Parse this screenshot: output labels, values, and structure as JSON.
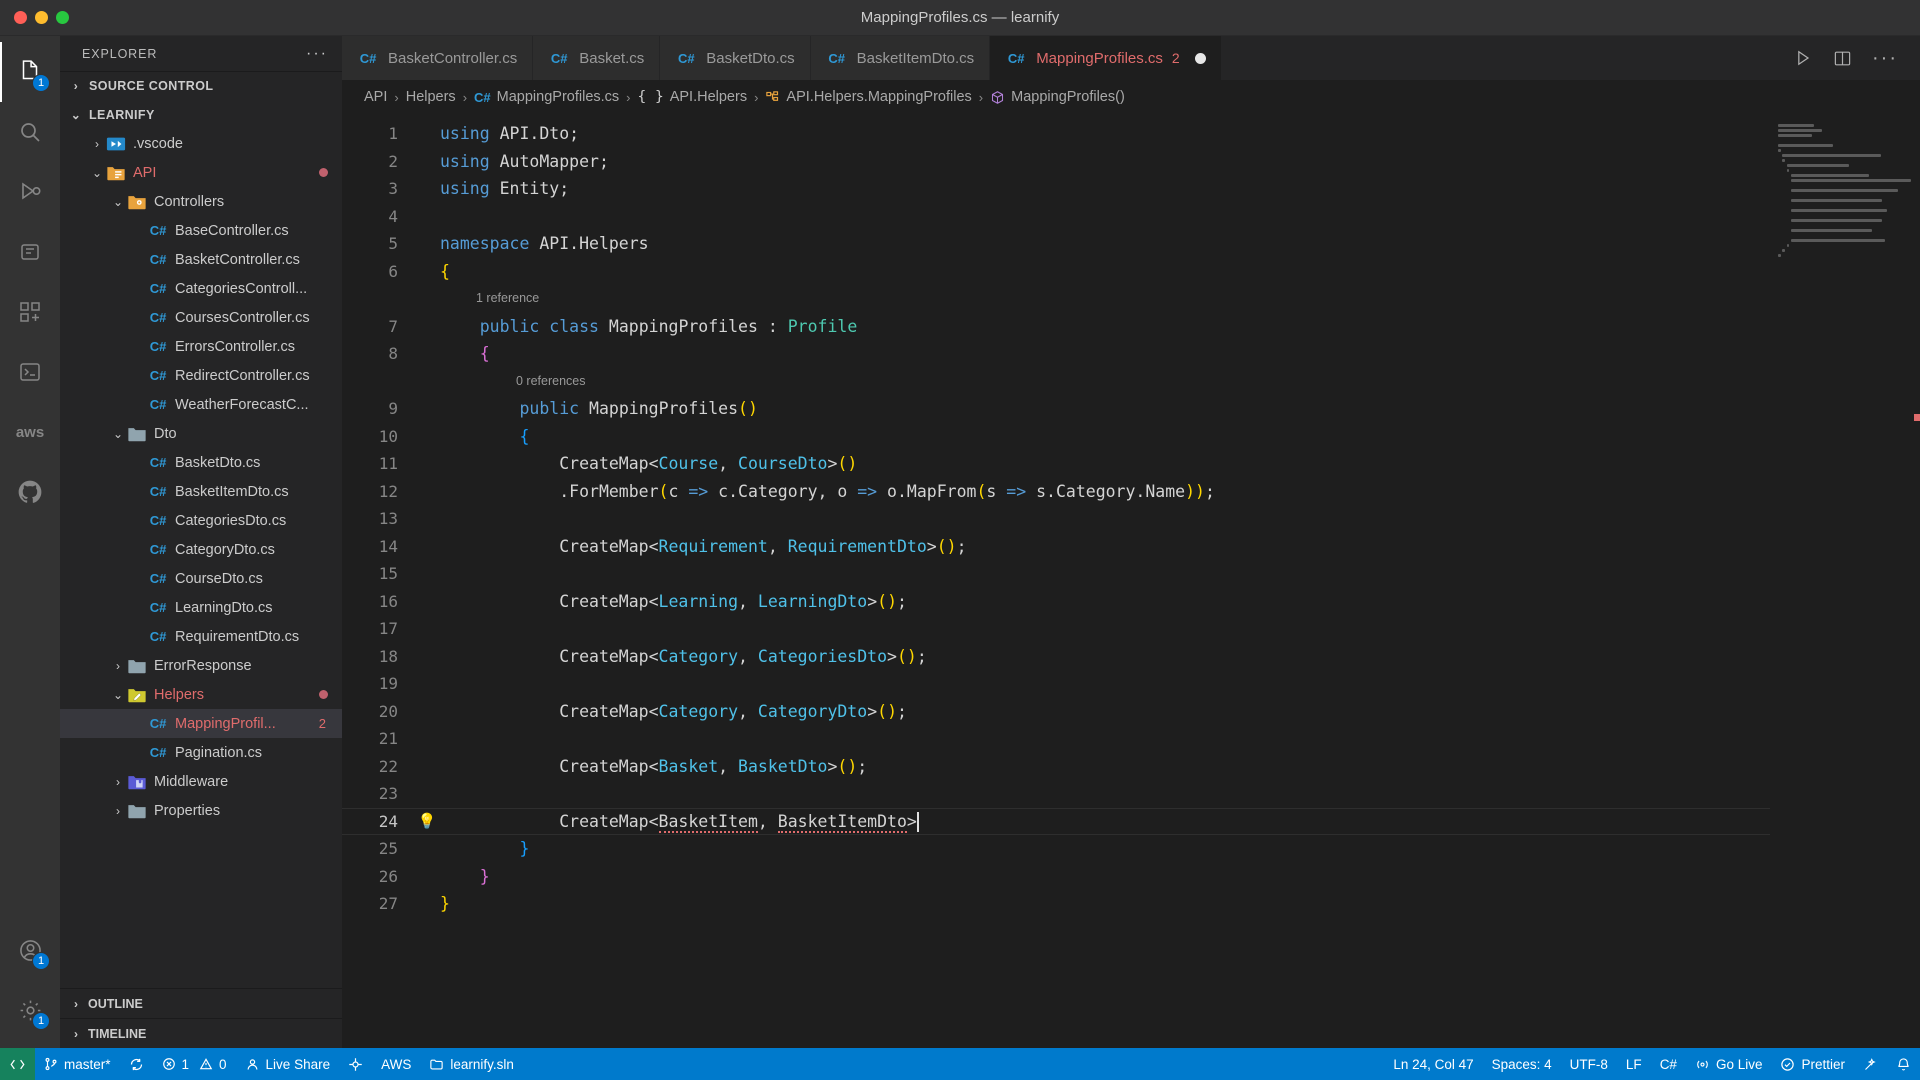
{
  "window": {
    "title": "MappingProfiles.cs — learnify"
  },
  "activity_bar": {
    "items": [
      {
        "name": "explorer",
        "icon": "files-icon",
        "badge": "1",
        "active": true
      },
      {
        "name": "search",
        "icon": "search-icon",
        "badge": ""
      },
      {
        "name": "run-debug",
        "icon": "run-debug-icon",
        "badge": ""
      },
      {
        "name": "testing",
        "icon": "beaker-icon",
        "badge": ""
      },
      {
        "name": "extensions",
        "icon": "extensions-icon",
        "badge": ""
      },
      {
        "name": "terminal-azure",
        "icon": "azure-icon",
        "badge": ""
      },
      {
        "name": "aws-toolkit",
        "icon": "aws-icon",
        "badge": ""
      },
      {
        "name": "github",
        "icon": "github-icon",
        "badge": ""
      }
    ],
    "bottom_items": [
      {
        "name": "accounts",
        "icon": "account-icon",
        "badge": "1"
      },
      {
        "name": "settings",
        "icon": "gear-icon",
        "badge": "1"
      }
    ]
  },
  "sidebar": {
    "header": "EXPLORER",
    "more_actions": "···",
    "sections": [
      {
        "label": "SOURCE CONTROL",
        "expanded": false
      }
    ],
    "root": {
      "label": "LEARNIFY",
      "expanded": true
    },
    "tree": [
      {
        "label": ".vscode",
        "type": "folder",
        "icon": "vscode-folder-icon",
        "depth": 1,
        "expanded": false,
        "color": "normal"
      },
      {
        "label": "API",
        "type": "folder",
        "icon": "api-folder-icon",
        "depth": 1,
        "expanded": true,
        "color": "error",
        "modified": true
      },
      {
        "label": "Controllers",
        "type": "folder",
        "icon": "controllers-folder-icon",
        "depth": 2,
        "expanded": true,
        "color": "normal"
      },
      {
        "label": "BaseController.cs",
        "type": "file",
        "icon": "csharp-icon",
        "depth": 3,
        "color": "normal"
      },
      {
        "label": "BasketController.cs",
        "type": "file",
        "icon": "csharp-icon",
        "depth": 3,
        "color": "normal"
      },
      {
        "label": "CategoriesControll...",
        "type": "file",
        "icon": "csharp-icon",
        "depth": 3,
        "color": "normal"
      },
      {
        "label": "CoursesController.cs",
        "type": "file",
        "icon": "csharp-icon",
        "depth": 3,
        "color": "normal"
      },
      {
        "label": "ErrorsController.cs",
        "type": "file",
        "icon": "csharp-icon",
        "depth": 3,
        "color": "normal"
      },
      {
        "label": "RedirectController.cs",
        "type": "file",
        "icon": "csharp-icon",
        "depth": 3,
        "color": "normal"
      },
      {
        "label": "WeatherForecastC...",
        "type": "file",
        "icon": "csharp-icon",
        "depth": 3,
        "color": "normal"
      },
      {
        "label": "Dto",
        "type": "folder",
        "icon": "plain-folder-icon",
        "depth": 2,
        "expanded": true,
        "color": "normal"
      },
      {
        "label": "BasketDto.cs",
        "type": "file",
        "icon": "csharp-icon",
        "depth": 3,
        "color": "normal"
      },
      {
        "label": "BasketItemDto.cs",
        "type": "file",
        "icon": "csharp-icon",
        "depth": 3,
        "color": "normal"
      },
      {
        "label": "CategoriesDto.cs",
        "type": "file",
        "icon": "csharp-icon",
        "depth": 3,
        "color": "normal"
      },
      {
        "label": "CategoryDto.cs",
        "type": "file",
        "icon": "csharp-icon",
        "depth": 3,
        "color": "normal"
      },
      {
        "label": "CourseDto.cs",
        "type": "file",
        "icon": "csharp-icon",
        "depth": 3,
        "color": "normal"
      },
      {
        "label": "LearningDto.cs",
        "type": "file",
        "icon": "csharp-icon",
        "depth": 3,
        "color": "normal"
      },
      {
        "label": "RequirementDto.cs",
        "type": "file",
        "icon": "csharp-icon",
        "depth": 3,
        "color": "normal"
      },
      {
        "label": "ErrorResponse",
        "type": "folder",
        "icon": "plain-folder-icon",
        "depth": 2,
        "expanded": false,
        "color": "normal"
      },
      {
        "label": "Helpers",
        "type": "folder",
        "icon": "helpers-folder-icon",
        "depth": 2,
        "expanded": true,
        "color": "error",
        "modified": true
      },
      {
        "label": "MappingProfil...",
        "type": "file",
        "icon": "csharp-icon",
        "depth": 3,
        "color": "error",
        "selected": true,
        "error_count": "2"
      },
      {
        "label": "Pagination.cs",
        "type": "file",
        "icon": "csharp-icon",
        "depth": 3,
        "color": "normal"
      },
      {
        "label": "Middleware",
        "type": "folder",
        "icon": "middleware-folder-icon",
        "depth": 2,
        "expanded": false,
        "color": "normal"
      },
      {
        "label": "Properties",
        "type": "folder",
        "icon": "plain-folder-icon",
        "depth": 2,
        "expanded": false,
        "color": "normal"
      }
    ],
    "footer_sections": [
      {
        "label": "OUTLINE",
        "expanded": false
      },
      {
        "label": "TIMELINE",
        "expanded": false
      }
    ]
  },
  "editor": {
    "tabs": [
      {
        "label": "BasketController.cs",
        "icon": "csharp-icon",
        "active": false,
        "dirty": false,
        "count": ""
      },
      {
        "label": "Basket.cs",
        "icon": "csharp-icon",
        "active": false,
        "dirty": false,
        "count": ""
      },
      {
        "label": "BasketDto.cs",
        "icon": "csharp-icon",
        "active": false,
        "dirty": false,
        "count": ""
      },
      {
        "label": "BasketItemDto.cs",
        "icon": "csharp-icon",
        "active": false,
        "dirty": false,
        "count": ""
      },
      {
        "label": "MappingProfiles.cs",
        "icon": "csharp-icon",
        "active": true,
        "dirty": true,
        "count": "2"
      }
    ],
    "actions": [
      {
        "name": "run-button",
        "icon": "play-icon"
      },
      {
        "name": "split-editor-button",
        "icon": "split-icon"
      },
      {
        "name": "more-actions-button",
        "icon": "ellipsis-icon"
      }
    ],
    "breadcrumbs": [
      {
        "label": "API",
        "icon": ""
      },
      {
        "label": "Helpers",
        "icon": ""
      },
      {
        "label": "MappingProfiles.cs",
        "icon": "csharp-icon"
      },
      {
        "label": "API.Helpers",
        "icon": "namespace-icon"
      },
      {
        "label": "API.Helpers.MappingProfiles",
        "icon": "class-icon"
      },
      {
        "label": "MappingProfiles()",
        "icon": "method-icon"
      }
    ],
    "codelens": [
      {
        "line": 7,
        "text": "1 reference"
      },
      {
        "line": 9,
        "text": "0 references"
      }
    ],
    "lines": [
      {
        "n": "1",
        "text": "using API.Dto;"
      },
      {
        "n": "2",
        "text": "using AutoMapper;"
      },
      {
        "n": "3",
        "text": "using Entity;"
      },
      {
        "n": "4",
        "text": ""
      },
      {
        "n": "5",
        "text": "namespace API.Helpers"
      },
      {
        "n": "6",
        "text": "{"
      },
      {
        "n": "7",
        "text": "    public class MappingProfiles : Profile"
      },
      {
        "n": "8",
        "text": "    {"
      },
      {
        "n": "9",
        "text": "        public MappingProfiles()"
      },
      {
        "n": "10",
        "text": "        {"
      },
      {
        "n": "11",
        "text": "            CreateMap<Course, CourseDto>()"
      },
      {
        "n": "12",
        "text": "            .ForMember(c => c.Category, o => o.MapFrom(s => s.Category.Name));"
      },
      {
        "n": "13",
        "text": ""
      },
      {
        "n": "14",
        "text": "            CreateMap<Requirement, RequirementDto>();"
      },
      {
        "n": "15",
        "text": ""
      },
      {
        "n": "16",
        "text": "            CreateMap<Learning, LearningDto>();"
      },
      {
        "n": "17",
        "text": ""
      },
      {
        "n": "18",
        "text": "            CreateMap<Category, CategoriesDto>();"
      },
      {
        "n": "19",
        "text": ""
      },
      {
        "n": "20",
        "text": "            CreateMap<Category, CategoryDto>();"
      },
      {
        "n": "21",
        "text": ""
      },
      {
        "n": "22",
        "text": "            CreateMap<Basket, BasketDto>();"
      },
      {
        "n": "23",
        "text": ""
      },
      {
        "n": "24",
        "text": "            CreateMap<BasketItem, BasketItemDto>"
      },
      {
        "n": "25",
        "text": "        }"
      },
      {
        "n": "26",
        "text": "    }"
      },
      {
        "n": "27",
        "text": "}"
      }
    ],
    "current_line": "24",
    "lightbulb_line": "24"
  },
  "status_bar": {
    "left": [
      {
        "name": "remote-indicator",
        "icon": "remote-icon",
        "label": ""
      },
      {
        "name": "branch",
        "icon": "branch-icon",
        "label": "master*"
      },
      {
        "name": "sync",
        "icon": "sync-icon",
        "label": ""
      },
      {
        "name": "problems",
        "icon": "error-warning-icon",
        "label_errors": "1",
        "label_warnings": "0"
      },
      {
        "name": "live-share",
        "icon": "live-share-icon",
        "label": "Live Share"
      },
      {
        "name": "ports",
        "icon": "ports-icon",
        "label": ""
      },
      {
        "name": "aws",
        "icon": "aws-icon",
        "label": "AWS"
      },
      {
        "name": "solution",
        "icon": "solution-icon",
        "label": "learnify.sln"
      }
    ],
    "right": [
      {
        "name": "cursor-position",
        "label": "Ln 24, Col 47"
      },
      {
        "name": "indentation",
        "label": "Spaces: 4"
      },
      {
        "name": "encoding",
        "label": "UTF-8"
      },
      {
        "name": "eol",
        "label": "LF"
      },
      {
        "name": "language-mode",
        "label": "C#"
      },
      {
        "name": "go-live",
        "icon": "broadcast-icon",
        "label": "Go Live"
      },
      {
        "name": "prettier",
        "icon": "check-icon",
        "label": "Prettier"
      },
      {
        "name": "editor-actions",
        "icon": "wand-icon",
        "label": ""
      },
      {
        "name": "notifications",
        "icon": "bell-icon",
        "label": ""
      }
    ]
  },
  "colors": {
    "accent": "#007acc",
    "error": "#e06c6c",
    "badge": "#0078d4",
    "remote": "#16825d"
  }
}
